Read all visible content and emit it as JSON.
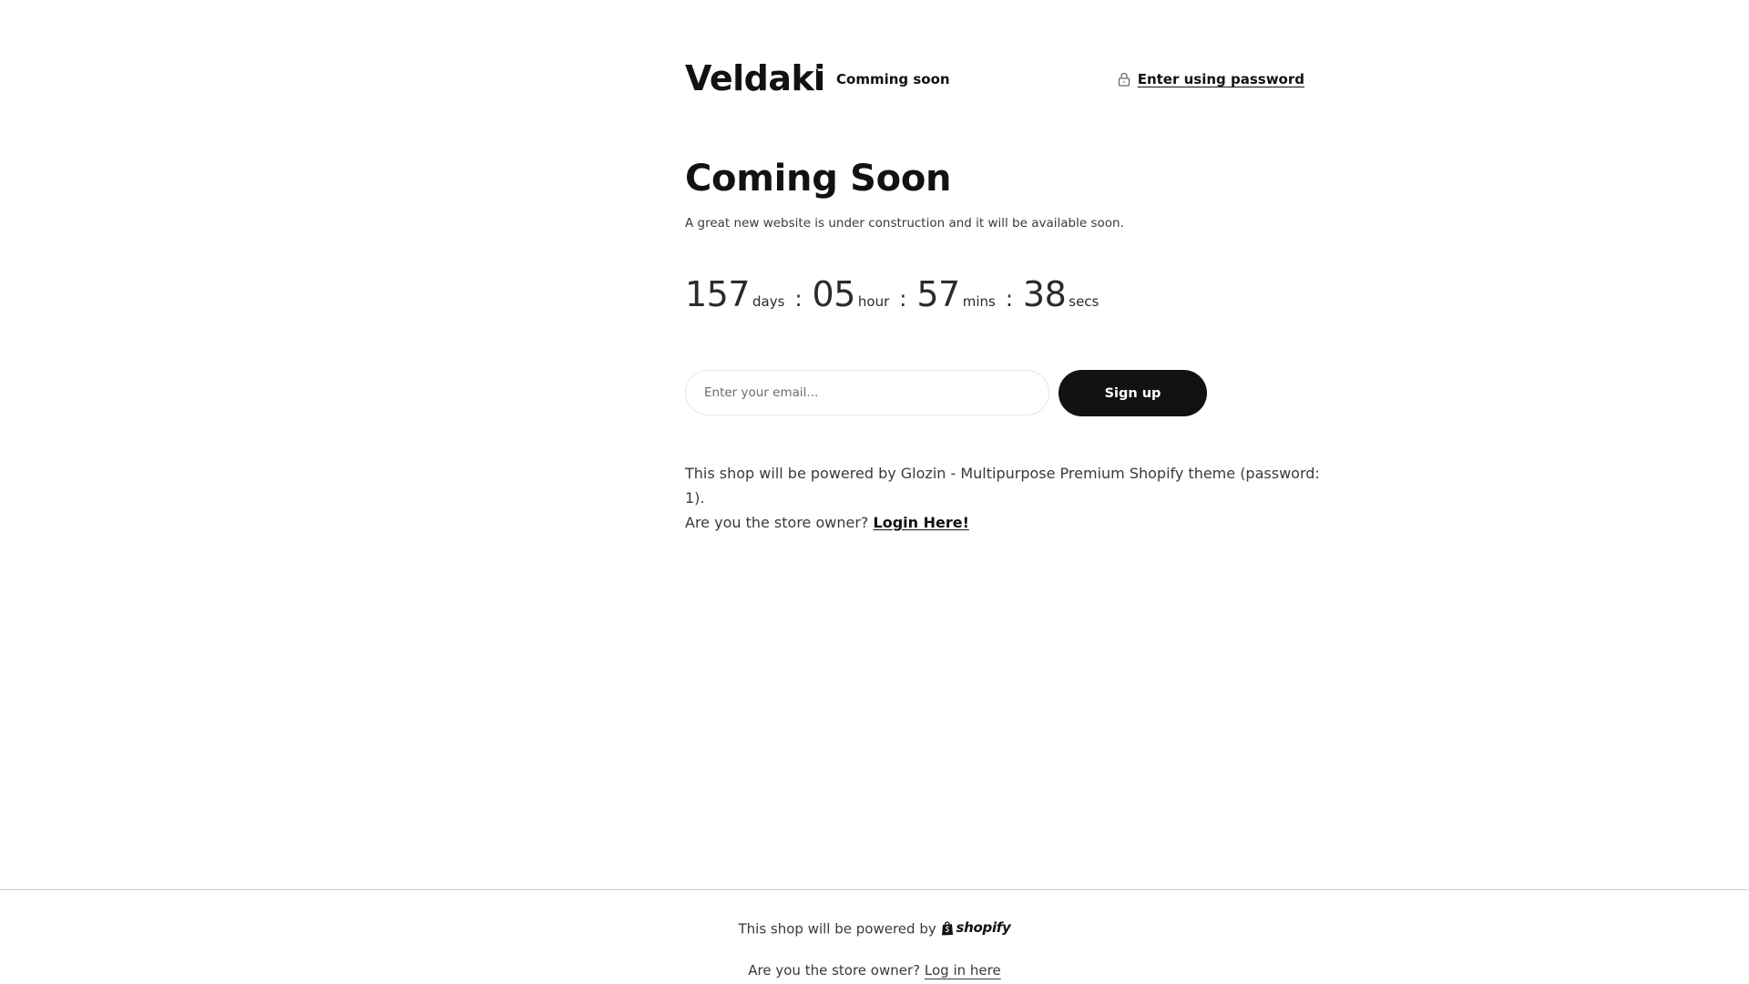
{
  "header": {
    "brand": "Veldaki",
    "tagline": "Comming soon",
    "password_link": "Enter using password",
    "password_icon": "lock-icon"
  },
  "hero": {
    "title": "Coming Soon",
    "subtitle": "A great new website is under construction and it will be available soon."
  },
  "countdown": {
    "days": "157",
    "days_label": "days",
    "hours": "05",
    "hours_label": "hour",
    "mins": "57",
    "mins_label": "mins",
    "secs": "38",
    "secs_label": "secs",
    "separator": ":"
  },
  "signup": {
    "email_placeholder": "Enter your email...",
    "button_label": "Sign up"
  },
  "info": {
    "line1": "This shop will be powered by Glozin - Multipurpose Premium Shopify theme (password: 1).",
    "line2_prefix": "Are you the store owner?",
    "login_link": "Login Here!"
  },
  "footer": {
    "powered_prefix": "This shop will be powered by",
    "shopify_word": "shopify",
    "shopify_icon": "shopify-bag-icon",
    "owner_prefix": "Are you the store owner?",
    "login_link": "Log in here"
  },
  "colors": {
    "text": "#121212",
    "muted_text": "#3a3a3a",
    "button_bg": "#121212",
    "button_text": "#ffffff",
    "input_border": "#e6e6e6",
    "footer_rule": "#cfcfcf"
  }
}
